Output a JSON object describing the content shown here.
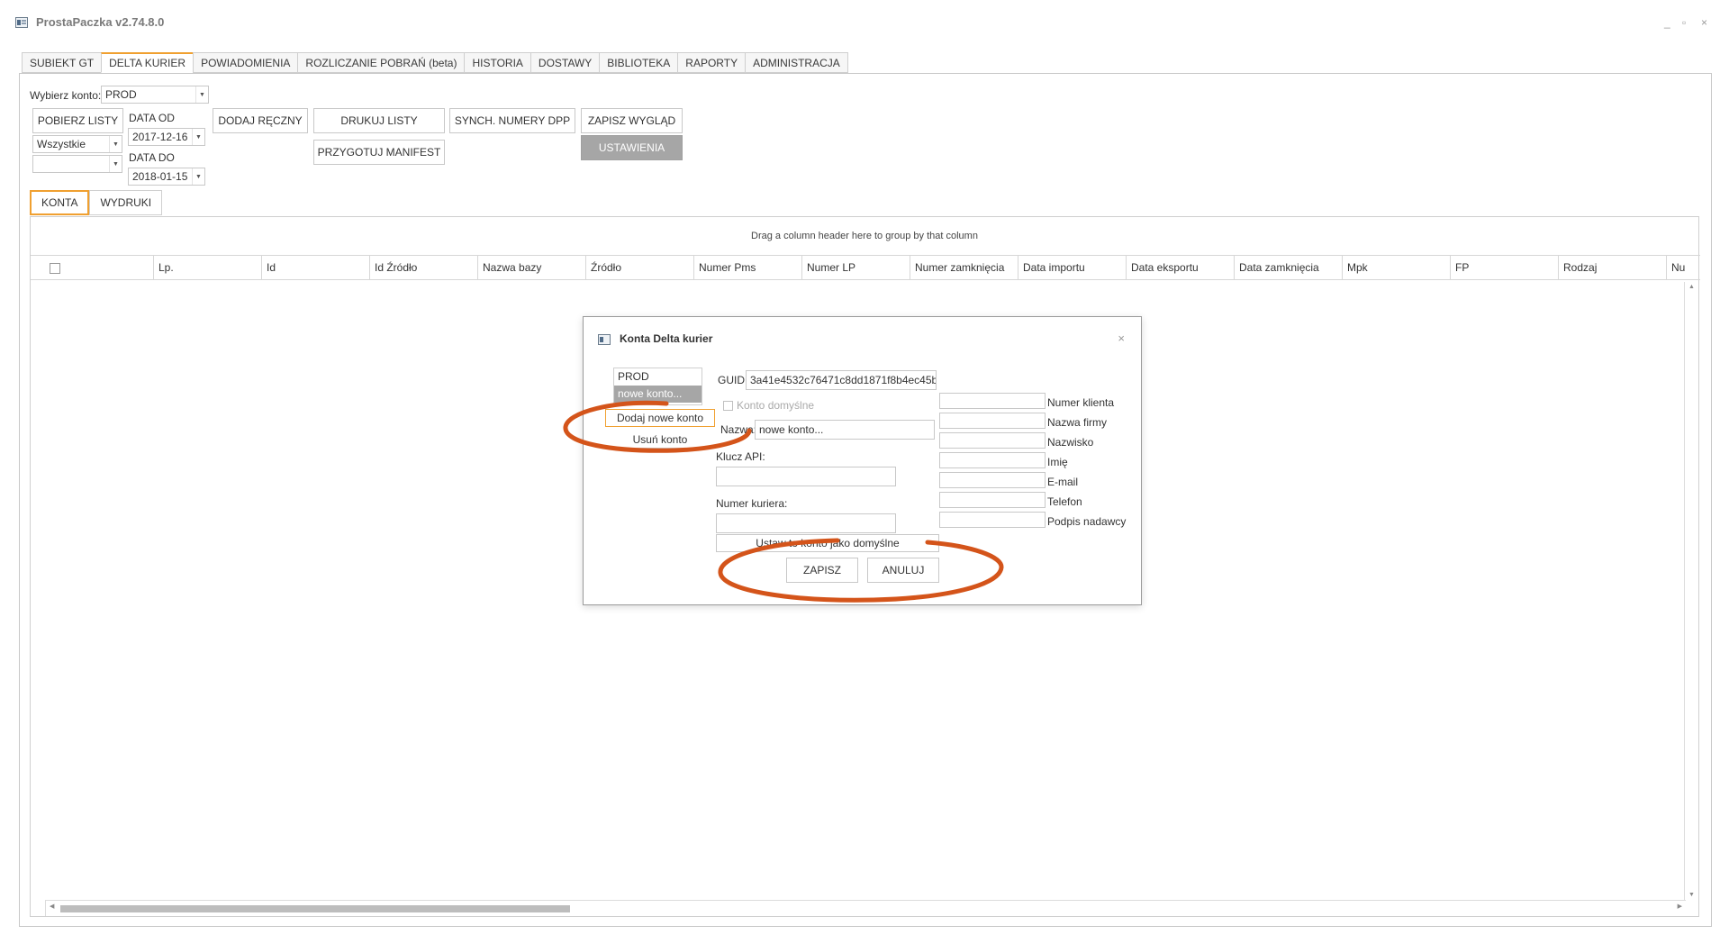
{
  "window": {
    "title": "ProstaPaczka v2.74.8.0",
    "controls": [
      "_",
      "▫",
      "×"
    ]
  },
  "tabs": [
    {
      "label": "SUBIEKT GT",
      "active": false
    },
    {
      "label": "DELTA KURIER",
      "active": true
    },
    {
      "label": "POWIADOMIENIA",
      "active": false
    },
    {
      "label": "ROZLICZANIE POBRAŃ (beta)",
      "active": false
    },
    {
      "label": "HISTORIA",
      "active": false
    },
    {
      "label": "DOSTAWY",
      "active": false
    },
    {
      "label": "BIBLIOTEKA",
      "active": false
    },
    {
      "label": "RAPORTY",
      "active": false
    },
    {
      "label": "ADMINISTRACJA",
      "active": false
    }
  ],
  "toolbar": {
    "account_label": "Wybierz konto:",
    "account_value": "PROD",
    "fetch_lists": "POBIERZ LISTY",
    "filter_value": "Wszystkie",
    "filter2_value": "",
    "date_from_label": "DATA OD",
    "date_from": "2017-12-16",
    "date_to_label": "DATA DO",
    "date_to": "2018-01-15",
    "add_manual": "DODAJ RĘCZNY",
    "print_lists": "DRUKUJ LISTY",
    "prepare_manifest": "PRZYGOTUJ MANIFEST",
    "sync_dpp": "SYNCH. NUMERY DPP",
    "save_view": "ZAPISZ WYGLĄD",
    "settings": "USTAWIENIA"
  },
  "subtabs": [
    {
      "label": "KONTA",
      "active": true
    },
    {
      "label": "WYDRUKI",
      "active": false
    }
  ],
  "grid": {
    "group_hint": "Drag a column header here to group by that column",
    "columns": [
      "Lp.",
      "Id",
      "Id Źródło",
      "Nazwa bazy",
      "Źródło",
      "Numer Pms",
      "Numer LP",
      "Numer zamknięcia",
      "Data importu",
      "Data eksportu",
      "Data zamknięcia",
      "Mpk",
      "FP",
      "Rodzaj",
      "Nu"
    ]
  },
  "dialog": {
    "title": "Konta Delta kurier",
    "accounts": [
      {
        "label": "PROD",
        "selected": false
      },
      {
        "label": "nowe konto...",
        "selected": true
      }
    ],
    "add_account": "Dodaj nowe konto",
    "remove_account": "Usuń konto",
    "guid_label": "GUID:",
    "guid_value": "3a41e4532c76471c8dd1871f8b4ec45b",
    "default_account_label": "Konto domyślne",
    "name_label": "Nazwa:",
    "name_value": "nowe konto...",
    "api_key_label": "Klucz API:",
    "api_key_value": "",
    "courier_number_label": "Numer kuriera:",
    "courier_number_value": "",
    "set_default": "Ustaw to konto jako domyślne",
    "save": "ZAPISZ",
    "cancel": "ANULUJ",
    "right_fields": [
      "Numer klienta",
      "Nazwa firmy",
      "Nazwisko",
      "Imię",
      "E-mail",
      "Telefon",
      "Podpis nadawcy"
    ]
  },
  "colors": {
    "accent": "#f0a030",
    "annotation": "#d4541a",
    "selected_bg": "#a6a6a6"
  }
}
